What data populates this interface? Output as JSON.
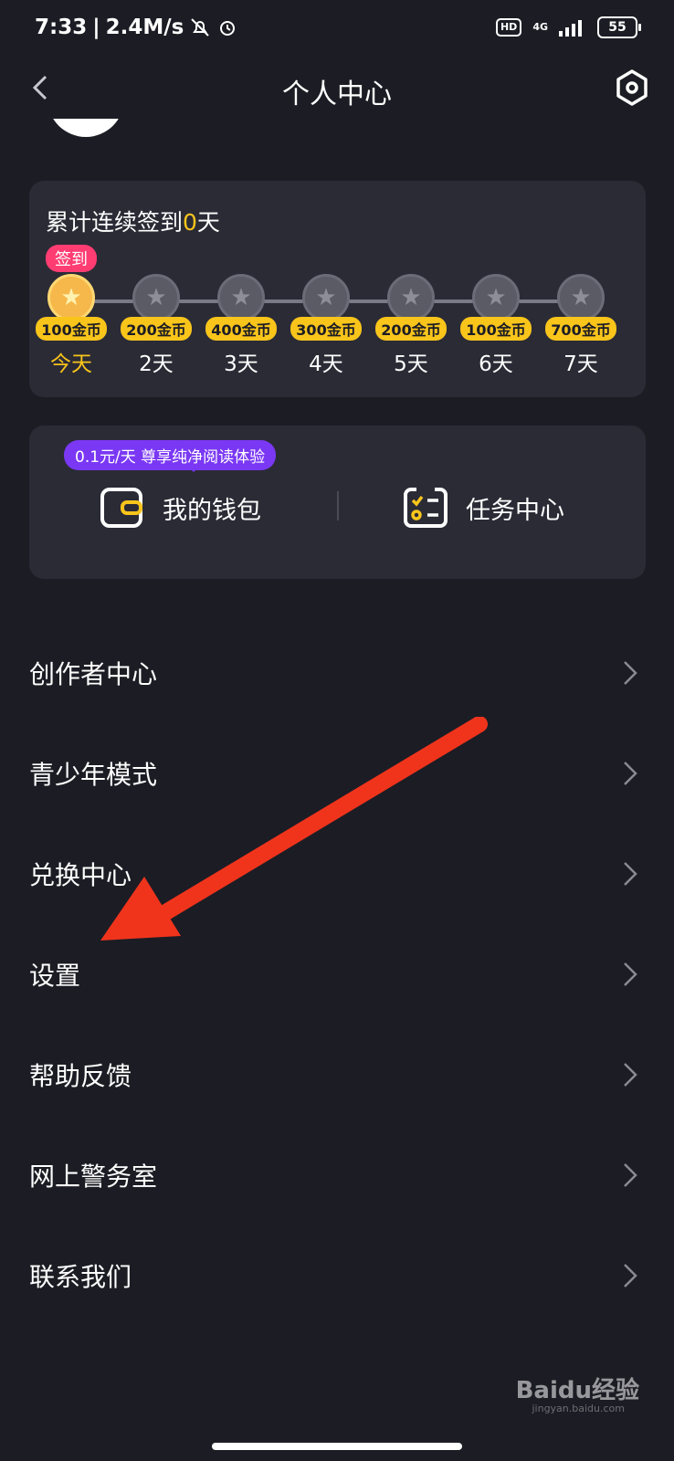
{
  "status": {
    "time": "7:33",
    "speed": "2.4M/s",
    "hd": "HD",
    "net": "4G",
    "battery": "55"
  },
  "header": {
    "title": "个人中心"
  },
  "signin": {
    "prefix": "累计连续签到",
    "days": "0",
    "suffix": "天",
    "tag": "签到",
    "rewards": [
      {
        "amount": "100金币",
        "day": "今天"
      },
      {
        "amount": "200金币",
        "day": "2天"
      },
      {
        "amount": "400金币",
        "day": "3天"
      },
      {
        "amount": "300金币",
        "day": "4天"
      },
      {
        "amount": "200金币",
        "day": "5天"
      },
      {
        "amount": "100金币",
        "day": "6天"
      },
      {
        "amount": "700金币",
        "day": "7天"
      }
    ]
  },
  "wallet": {
    "promo": "0.1元/天 尊享纯净阅读体验",
    "wallet_label": "我的钱包",
    "task_label": "任务中心"
  },
  "menu": [
    "创作者中心",
    "青少年模式",
    "兑换中心",
    "设置",
    "帮助反馈",
    "网上警务室",
    "联系我们"
  ],
  "watermark": {
    "text": "Baidu经验",
    "url": "jingyan.baidu.com"
  },
  "colors": {
    "background": "#1c1c24",
    "card": "#2b2b36",
    "gold": "#f9c51b",
    "sign_tag": "#ff3d72",
    "promo": "#7a38f4",
    "arrow": "#f0341c"
  },
  "icons": [
    "back-arrow-icon",
    "settings-icon",
    "wallet-icon",
    "task-icon",
    "chevron-right-icon",
    "star-coin-icon"
  ]
}
